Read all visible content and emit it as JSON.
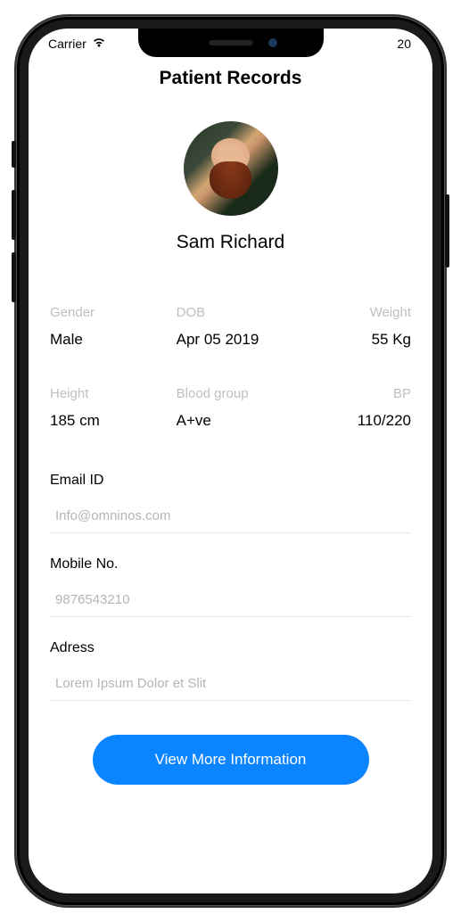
{
  "status_bar": {
    "carrier": "Carrier",
    "time_partial": "20"
  },
  "page": {
    "title": "Patient Records"
  },
  "patient": {
    "name": "Sam Richard"
  },
  "info": {
    "gender": {
      "label": "Gender",
      "value": "Male"
    },
    "dob": {
      "label": "DOB",
      "value": "Apr 05 2019"
    },
    "weight": {
      "label": "Weight",
      "value": "55 Kg"
    },
    "height": {
      "label": "Height",
      "value": "185 cm"
    },
    "blood_group": {
      "label": "Blood group",
      "value": "A+ve"
    },
    "bp": {
      "label": "BP",
      "value": "110/220"
    }
  },
  "fields": {
    "email": {
      "label": "Email ID",
      "placeholder": "Info@omninos.com"
    },
    "mobile": {
      "label": "Mobile No.",
      "placeholder": "9876543210"
    },
    "address": {
      "label": "Adress",
      "placeholder": "Lorem Ipsum Dolor et Slit"
    }
  },
  "cta": {
    "label": "View More Information"
  }
}
